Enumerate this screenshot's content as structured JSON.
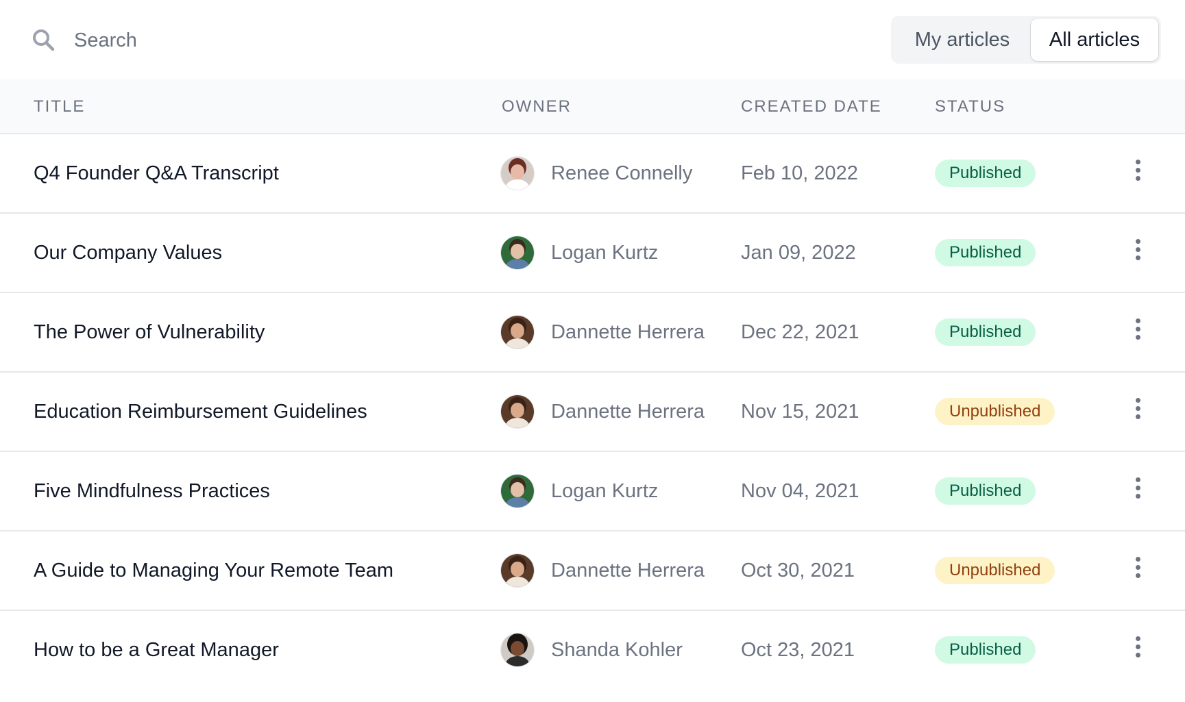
{
  "search": {
    "placeholder": "Search",
    "value": ""
  },
  "toggle": {
    "my_label": "My articles",
    "all_label": "All articles",
    "selected": "All articles"
  },
  "table": {
    "headers": {
      "title": "TITLE",
      "owner": "OWNER",
      "created_date": "CREATED DATE",
      "status": "STATUS"
    },
    "rows": [
      {
        "title": "Q4 Founder Q&A Transcript",
        "owner": "Renee Connelly",
        "created_date": "Feb 10, 2022",
        "status": "Published"
      },
      {
        "title": "Our Company Values",
        "owner": "Logan Kurtz",
        "created_date": "Jan 09, 2022",
        "status": "Published"
      },
      {
        "title": "The Power of Vulnerability",
        "owner": "Dannette Herrera",
        "created_date": "Dec 22, 2021",
        "status": "Published"
      },
      {
        "title": "Education Reimbursement Guidelines",
        "owner": "Dannette Herrera",
        "created_date": "Nov 15, 2021",
        "status": "Unpublished"
      },
      {
        "title": "Five Mindfulness Practices",
        "owner": "Logan Kurtz",
        "created_date": "Nov 04, 2021",
        "status": "Published"
      },
      {
        "title": "A Guide to Managing Your Remote Team",
        "owner": "Dannette Herrera",
        "created_date": "Oct 30, 2021",
        "status": "Unpublished"
      },
      {
        "title": "How to be a Great Manager",
        "owner": "Shanda Kohler",
        "created_date": "Oct 23, 2021",
        "status": "Published"
      }
    ]
  },
  "colors": {
    "published_bg": "#d1fae5",
    "published_text": "#065f46",
    "unpublished_bg": "#fef3c7",
    "unpublished_text": "#92400e",
    "muted_text": "#6b7280",
    "primary_text": "#111827"
  },
  "icons": {
    "search": "search-icon",
    "row_menu": "more-vertical-icon",
    "avatar": "avatar"
  }
}
